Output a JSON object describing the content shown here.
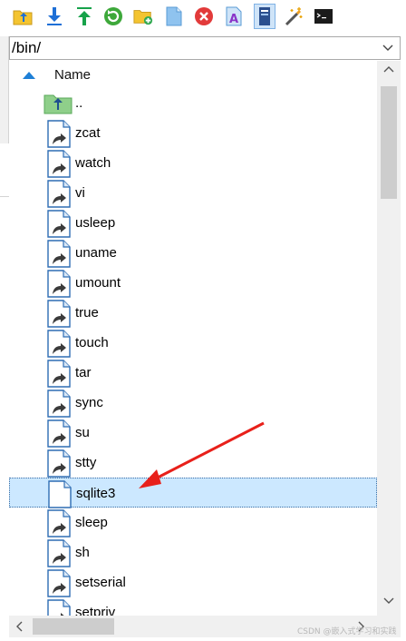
{
  "toolbar": {
    "buttons": [
      {
        "icon": "parent-folder-icon"
      },
      {
        "icon": "download-icon"
      },
      {
        "icon": "upload-icon"
      },
      {
        "icon": "refresh-icon"
      },
      {
        "icon": "new-folder-icon"
      },
      {
        "icon": "new-file-icon"
      },
      {
        "icon": "delete-icon"
      },
      {
        "icon": "rename-icon"
      },
      {
        "icon": "properties-icon"
      },
      {
        "icon": "magic-wand-icon"
      },
      {
        "icon": "terminal-icon"
      }
    ]
  },
  "path_bar": {
    "value": "/bin/"
  },
  "file_list": {
    "column_header": "Name",
    "sort": "ascending",
    "rows": [
      {
        "name": "..",
        "type": "parent",
        "selected": false
      },
      {
        "name": "zcat",
        "type": "symlink",
        "selected": false
      },
      {
        "name": "watch",
        "type": "symlink",
        "selected": false
      },
      {
        "name": "vi",
        "type": "symlink",
        "selected": false
      },
      {
        "name": "usleep",
        "type": "symlink",
        "selected": false
      },
      {
        "name": "uname",
        "type": "symlink",
        "selected": false
      },
      {
        "name": "umount",
        "type": "symlink",
        "selected": false
      },
      {
        "name": "true",
        "type": "symlink",
        "selected": false
      },
      {
        "name": "touch",
        "type": "symlink",
        "selected": false
      },
      {
        "name": "tar",
        "type": "symlink",
        "selected": false
      },
      {
        "name": "sync",
        "type": "symlink",
        "selected": false
      },
      {
        "name": "su",
        "type": "symlink",
        "selected": false
      },
      {
        "name": "stty",
        "type": "symlink",
        "selected": false
      },
      {
        "name": "sqlite3",
        "type": "file",
        "selected": true
      },
      {
        "name": "sleep",
        "type": "symlink",
        "selected": false
      },
      {
        "name": "sh",
        "type": "symlink",
        "selected": false
      },
      {
        "name": "setserial",
        "type": "symlink",
        "selected": false
      },
      {
        "name": "setpriv",
        "type": "symlink",
        "selected": false
      }
    ]
  },
  "colors": {
    "selection_bg": "#cce8ff",
    "selection_border": "#3a6ea5",
    "annotation_arrow": "#e8201a",
    "accent_blue": "#1e7fd6"
  },
  "watermark": "CSDN @嵌入式学习和实践"
}
